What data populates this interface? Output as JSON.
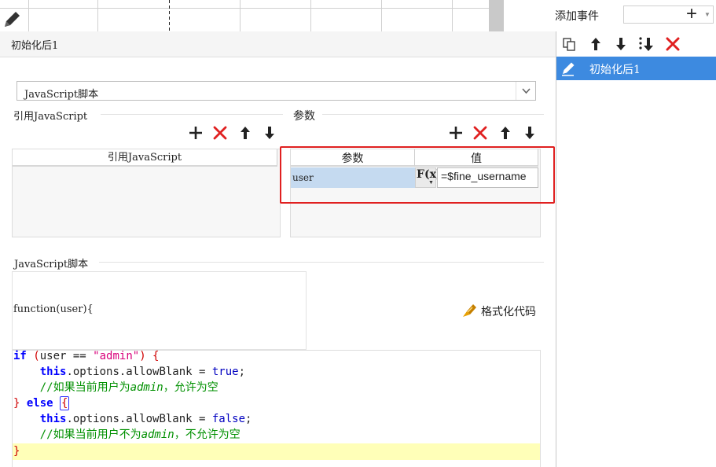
{
  "colors": {
    "accent_blue": "#3d8ae0",
    "highlight_red": "#e02020",
    "delete_red": "#e02020"
  },
  "panel": {
    "title": "初始化后1"
  },
  "event_panel": {
    "add_label": "添加事件",
    "add_icon": "plus-icon",
    "toolbar_icons": [
      "copy-icon",
      "arrow-up-icon",
      "arrow-down-icon",
      "move-bottom-icon",
      "delete-icon"
    ],
    "items": [
      {
        "label": "初始化后1",
        "icon": "edit-icon",
        "selected": true
      }
    ]
  },
  "script_type": {
    "selected": "JavaScript脚本"
  },
  "ref_js": {
    "section_label": "引用JavaScript",
    "column_header": "引用JavaScript",
    "actions": [
      "plus-icon",
      "delete-icon",
      "arrow-up-icon",
      "arrow-down-icon"
    ]
  },
  "params": {
    "section_label": "参数",
    "headers": {
      "name": "参数",
      "value": "值"
    },
    "rows": [
      {
        "name": "user",
        "formula_icon": "F(x)",
        "value": "=$fine_username"
      }
    ],
    "actions": [
      "plus-icon",
      "delete-icon",
      "arrow-up-icon",
      "arrow-down-icon"
    ]
  },
  "script": {
    "section_label": "JavaScript脚本",
    "signature": "function(user){",
    "format_button": "格式化代码",
    "code_lines": [
      "if (user == \"admin\") {",
      "    this.options.allowBlank = true;",
      "    //如果当前用户为admin，允许为空",
      "} else {",
      "    this.options.allowBlank = false;",
      "    //如果当前用户不为admin，不允许为空",
      "}"
    ]
  }
}
